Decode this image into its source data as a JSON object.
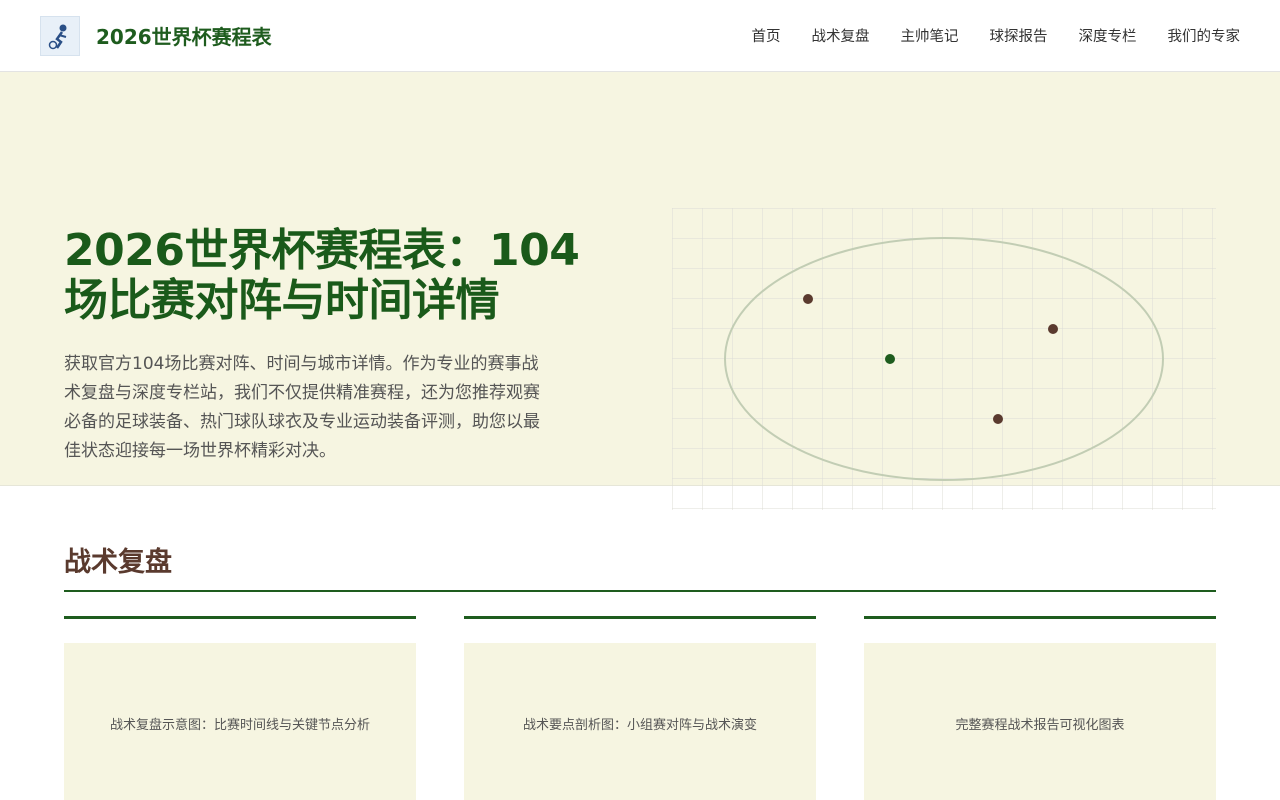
{
  "header": {
    "site_title": "2026世界杯赛程表",
    "logo_icon": "soccer-player-logo-icon",
    "nav": [
      {
        "label": "首页"
      },
      {
        "label": "战术复盘"
      },
      {
        "label": "主帅笔记"
      },
      {
        "label": "球探报告"
      },
      {
        "label": "深度专栏"
      },
      {
        "label": "我们的专家"
      }
    ]
  },
  "hero": {
    "title": "2026世界杯赛程表：104场比赛对阵与时间详情",
    "description": "获取官方104场比赛对阵、时间与城市详情。作为专业的赛事战术复盘与深度专栏站，我们不仅提供精准赛程，还为您推荐观赛必备的足球装备、热门球队球衣及专业运动装备评测，助您以最佳状态迎接每一场世界杯精彩对决。"
  },
  "section": {
    "title": "战术复盘",
    "cards": [
      {
        "caption": "战术复盘示意图：比赛时间线与关键节点分析"
      },
      {
        "caption": "战术要点剖析图：小组赛对阵与战术演变"
      },
      {
        "caption": "完整赛程战术报告可视化图表"
      }
    ]
  },
  "colors": {
    "primary_green": "#1e5c1e",
    "accent_brown": "#5a3a2e",
    "hero_bg": "#f6f5e1"
  }
}
